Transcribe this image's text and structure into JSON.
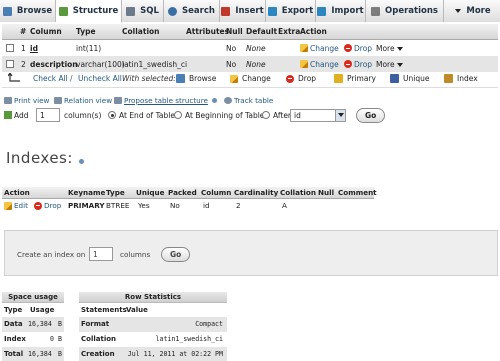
{
  "tabs": [
    {
      "label": "Browse",
      "icon": "browse-icon",
      "color": "#4a7fb5"
    },
    {
      "label": "Structure",
      "icon": "structure-icon",
      "color": "#5a9a3c",
      "active": true
    },
    {
      "label": "SQL",
      "icon": "sql-icon",
      "color": "#6c7a8c"
    },
    {
      "label": "Search",
      "icon": "search-icon",
      "color": "#3a6ea5"
    },
    {
      "label": "Insert",
      "icon": "insert-icon",
      "color": "#c0392b"
    },
    {
      "label": "Export",
      "icon": "export-icon",
      "color": "#2e86c1"
    },
    {
      "label": "Import",
      "icon": "import-icon",
      "color": "#2e86c1"
    },
    {
      "label": "Operations",
      "icon": "wrench-icon",
      "color": "#7d7d7d"
    },
    {
      "label": "More",
      "icon": "chevron-down-icon",
      "color": "#333333"
    }
  ],
  "structure": {
    "headers": [
      "#",
      "Column",
      "Type",
      "Collation",
      "Attributes",
      "Null",
      "Default",
      "Extra",
      "Action"
    ],
    "rows": [
      {
        "num": "1",
        "column": "id",
        "type": "int(11)",
        "collation": "",
        "attributes": "",
        "null": "No",
        "default": "None",
        "extra": ""
      },
      {
        "num": "2",
        "column": "description",
        "type": "varchar(100)",
        "collation": "latin1_swedish_ci",
        "attributes": "",
        "null": "No",
        "default": "None",
        "extra": ""
      }
    ],
    "actions": {
      "change": "Change",
      "drop": "Drop",
      "more": "More"
    }
  },
  "selection": {
    "check_all": "Check All",
    "separator": " / ",
    "uncheck_all": "Uncheck All",
    "with_selected": "With selected:",
    "buttons": [
      "Browse",
      "Change",
      "Drop",
      "Primary",
      "Unique",
      "Index"
    ]
  },
  "links": {
    "print_view": "Print view",
    "relation_view": "Relation view",
    "propose_structure": "Propose table structure",
    "track_table": "Track table"
  },
  "add_column": {
    "label": "Add",
    "count": "1",
    "columns_label": "column(s)",
    "at_end": "At End of Table",
    "at_beginning": "At Beginning of Table",
    "after": "After",
    "after_value": "id",
    "go": "Go"
  },
  "indexes": {
    "title": "Indexes:",
    "headers": [
      "Action",
      "Keyname",
      "Type",
      "Unique",
      "Packed",
      "Column",
      "Cardinality",
      "Collation",
      "Null",
      "Comment"
    ],
    "row": {
      "edit": "Edit",
      "drop": "Drop",
      "keyname": "PRIMARY",
      "type": "BTREE",
      "unique": "Yes",
      "packed": "No",
      "column": "id",
      "cardinality": "2",
      "collation": "A",
      "null": "",
      "comment": ""
    },
    "create_label": "Create an index on",
    "create_count": "1",
    "columns_label": "columns",
    "go": "Go"
  },
  "space_usage": {
    "title": "Space usage",
    "headers": [
      "Type",
      "Usage"
    ],
    "rows": [
      {
        "type": "Data",
        "value": "16,384",
        "unit": "B"
      },
      {
        "type": "Index",
        "value": "0",
        "unit": "B"
      },
      {
        "type": "Total",
        "value": "16,384",
        "unit": "B"
      }
    ]
  },
  "row_stats": {
    "title": "Row Statistics",
    "headers": [
      "Statements",
      "Value"
    ],
    "rows": [
      {
        "statement": "Format",
        "value": "Compact"
      },
      {
        "statement": "Collation",
        "value": "latin1_swedish_ci"
      },
      {
        "statement": "Creation",
        "value": "Jul 11, 2011 at 02:22 PM"
      }
    ]
  }
}
